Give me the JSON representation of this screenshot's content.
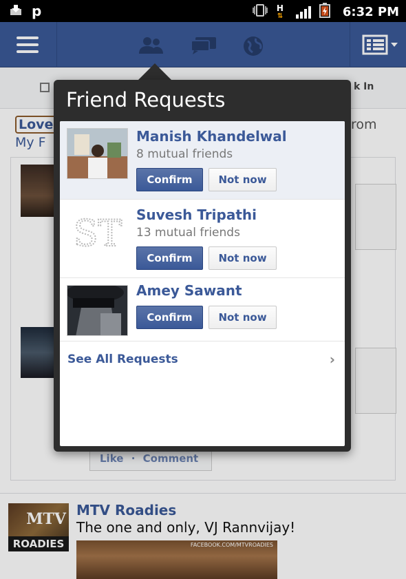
{
  "status_bar": {
    "time": "6:32 PM",
    "network_label": "H",
    "app_letter": "p",
    "icons": [
      "download-icon",
      "p-icon",
      "vibrate-icon",
      "hspa-icon",
      "signal-icon",
      "battery-icon"
    ]
  },
  "topbar": {
    "icons": [
      "menu-icon",
      "friend-requests-icon",
      "messages-icon",
      "notifications-icon",
      "list-icon"
    ],
    "color": "#3b5998"
  },
  "feed": {
    "checkin_label": "k In",
    "header_line1": "Love",
    "header_line2": "My F",
    "header_right": "rom",
    "like_label": "Like",
    "like_separator": "·",
    "comment_label": "Comment",
    "post": {
      "name": "MTV Roadies",
      "text": "The one and only, VJ Rannvijay!",
      "logo_text": "ROADIES",
      "logo_mtv": "MTV",
      "image_caption": "FACEBOOK.COM/MTVROADIES"
    }
  },
  "friend_requests": {
    "title": "Friend Requests",
    "requests": [
      {
        "name": "Manish Khandelwal",
        "mutual": "8 mutual friends",
        "confirm": "Confirm",
        "not_now": "Not now"
      },
      {
        "name": "Suvesh Tripathi",
        "mutual": "13 mutual friends",
        "confirm": "Confirm",
        "not_now": "Not now",
        "avatar_text": "ST"
      },
      {
        "name": "Amey Sawant",
        "confirm": "Confirm",
        "not_now": "Not now"
      }
    ],
    "see_all": "See All Requests",
    "see_all_chevron": "›"
  }
}
